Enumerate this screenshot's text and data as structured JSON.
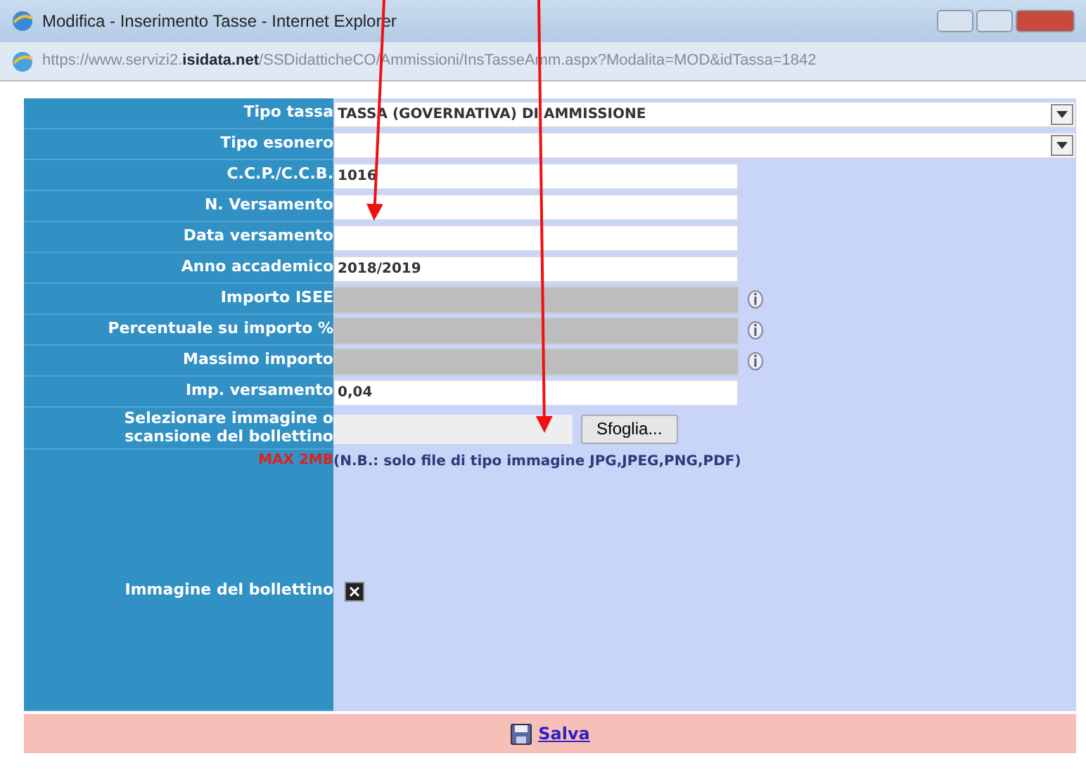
{
  "window": {
    "title": "Modifica - Inserimento Tasse - Internet Explorer"
  },
  "address_bar": {
    "url": "https://www.servizi2.**isidata.net**/SSDidatticheCO/Ammissioni/InsTasseAmm.aspx?Modalita=MOD&idTassa=1842"
  },
  "form": {
    "rows": [
      {
        "label": "Tipo tassa",
        "kind": "select",
        "value": "TASSA (GOVERNATIVA) DI AMMISSIONE"
      },
      {
        "label": "Tipo esonero",
        "kind": "select"
      },
      {
        "label": "C.C.P./C.C.B.",
        "kind": "text",
        "value": "1016"
      },
      {
        "label": "N. Versamento",
        "kind": "text"
      },
      {
        "label": "Data versamento",
        "kind": "text"
      },
      {
        "label": "Anno accademico",
        "kind": "text",
        "value": "2018/2019"
      },
      {
        "label": "Importo ISEE",
        "kind": "readonly"
      },
      {
        "label": "Percentuale su importo %",
        "kind": "readonly"
      },
      {
        "label": "Massimo importo",
        "kind": "readonly"
      },
      {
        "label": "Imp. versamento",
        "kind": "text",
        "value": "0,04"
      }
    ],
    "file_row": {
      "label": "Selezionare immagine o scansione del bollettino",
      "button": "Sfoglia...",
      "limit": "MAX 2MB",
      "note": "(N.B.: solo file di tipo immagine JPG,JPEG,PNG,PDF)"
    },
    "image_row": {
      "label": "Immagine del bollettino"
    }
  },
  "footer": {
    "save_link": "Salva"
  }
}
